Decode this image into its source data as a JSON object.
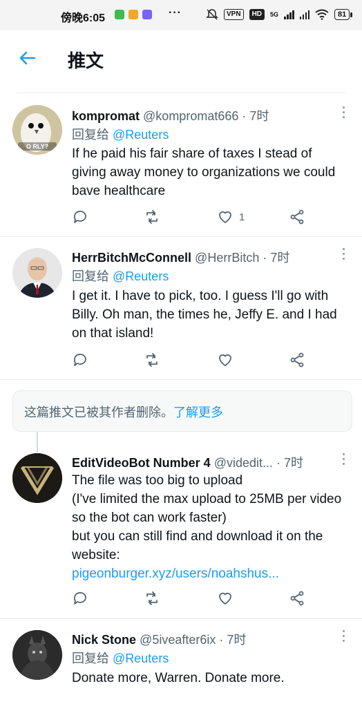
{
  "status_bar": {
    "time": "傍晚6:05",
    "more": "···",
    "vpn": "VPN",
    "hd": "HD",
    "net": "5G",
    "battery": "81"
  },
  "header": {
    "title": "推文"
  },
  "tweets": [
    {
      "name": "kompromat",
      "handle": "@kompromat666",
      "time": "7时",
      "reply_prefix": "回复给",
      "reply_to": "@Reuters",
      "body": "If he paid his fair share of taxes I stead of giving away money to organizations we could bave healthcare",
      "like_count": "1"
    },
    {
      "name": "HerrBitchMcConnell",
      "handle": "@HerrBitch",
      "time": "7时",
      "reply_prefix": "回复给",
      "reply_to": "@Reuters",
      "body": "I get it. I have to pick, too. I guess I'll go with Billy. Oh man, the times he, Jeffy E. and I had on that island!",
      "like_count": ""
    },
    {
      "name": "EditVideoBot Number 4",
      "handle": "@videdit...",
      "time": "7时",
      "body_lines": [
        "The file was too big to upload",
        "(I've limited the max upload to 25MB per video so the bot can work faster)",
        "but you can still find and download it on the website:"
      ],
      "link": "pigeonburger.xyz/users/noahshus...",
      "like_count": ""
    },
    {
      "name": "Nick Stone",
      "handle": "@5iveafter6ix",
      "time": "7时",
      "reply_prefix": "回复给",
      "reply_to": "@Reuters",
      "body": "Donate more, Warren. Donate more."
    }
  ],
  "deleted_notice": {
    "text": "这篇推文已被其作者删除。",
    "learn_more": "了解更多"
  },
  "avatar_text": {
    "owl": "O RLY?"
  },
  "colors": {
    "accent": "#1d9bf0",
    "secondary_text": "#536471",
    "divider": "#e6e9ec"
  }
}
